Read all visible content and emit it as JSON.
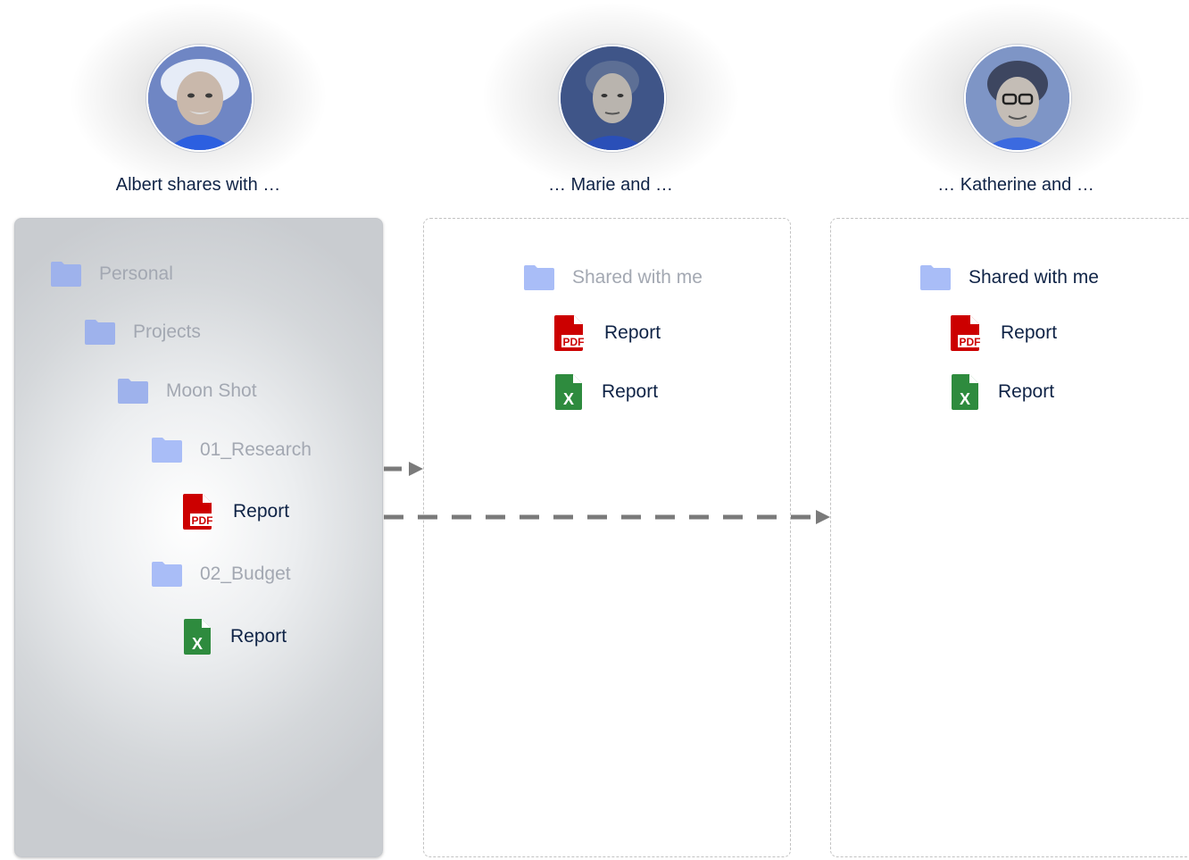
{
  "people": [
    {
      "caption": "Albert shares with …"
    },
    {
      "caption": "… Marie and …"
    },
    {
      "caption": "… Katherine and …"
    }
  ],
  "albert_tree": {
    "personal": "Personal",
    "projects": "Projects",
    "moon_shot": "Moon Shot",
    "research": "01_Research",
    "research_report": "Report",
    "budget": "02_Budget",
    "budget_report": "Report"
  },
  "marie_tree": {
    "shared": "Shared with me",
    "pdf_report": "Report",
    "xls_report": "Report"
  },
  "katherine_tree": {
    "shared": "Shared with me",
    "pdf_report": "Report",
    "xls_report": "Report"
  },
  "icons": {
    "folder": "folder-icon",
    "pdf": "pdf-file-icon",
    "spreadsheet": "spreadsheet-file-icon",
    "pdf_badge": "PDF",
    "xls_badge": "X"
  },
  "colors": {
    "folder": "#a9bdf7",
    "pdf": "#cc0000",
    "excel": "#2e8b3e",
    "arrow": "#7a7a7a",
    "text": "#0f2346"
  }
}
